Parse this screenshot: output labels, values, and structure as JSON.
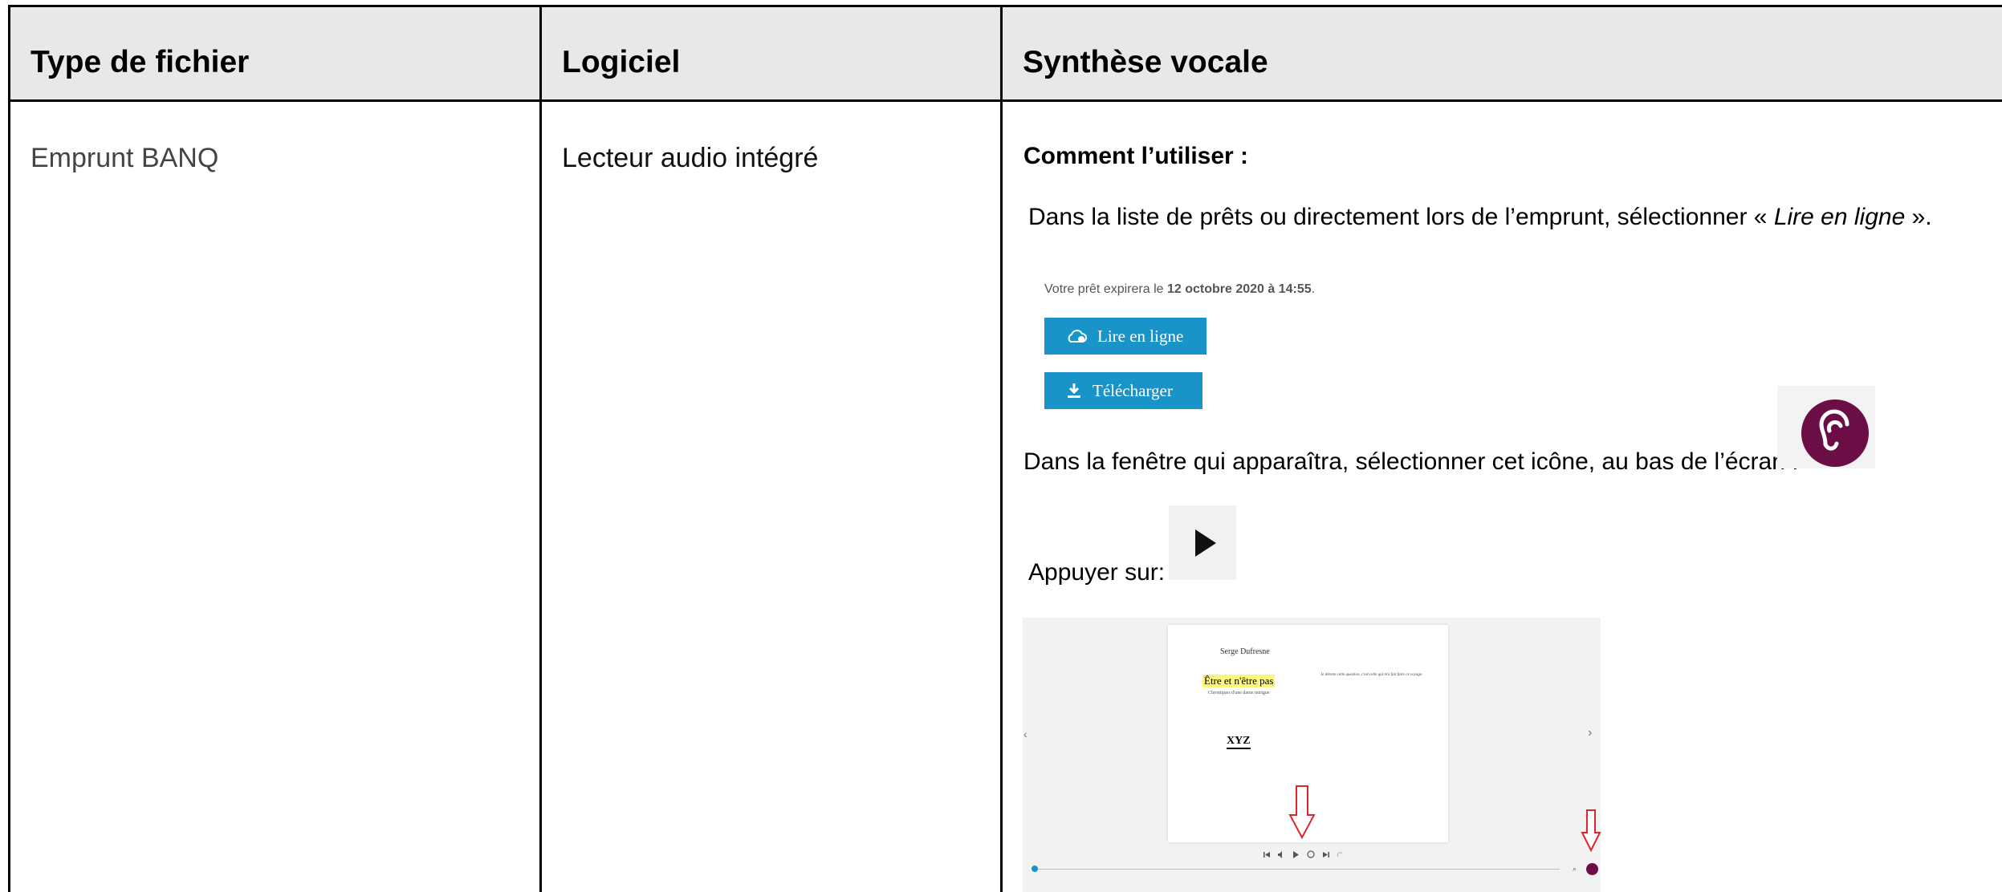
{
  "headers": [
    "Type de fichier",
    "Logiciel",
    "Synthèse vocale"
  ],
  "row": {
    "file_type": "Emprunt BANQ",
    "software": "Lecteur audio intégré",
    "howto_title": "Comment l’utiliser :",
    "step1_before": "Dans la liste de prêts ou directement lors de l’emprunt, sélectionner « ",
    "step1_em": "Lire en ligne",
    "step1_after": " ».",
    "loan_note_before": "Votre prêt expirera le ",
    "loan_note_bold": "12 octobre 2020 à 14:55",
    "loan_note_after": ".",
    "read_online_label": "Lire en ligne",
    "download_label": "Télécharger",
    "step2": "Dans la fenêtre qui apparaîtra, sélectionner cet icône, au bas de l’écran :",
    "step3": "Appuyer sur:",
    "reader": {
      "author": "Serge Dufresne",
      "book_title": "Être et n'être pas",
      "book_subtitle": "Chroniques d'une dame intrigue",
      "publisher_logo": "XYZ",
      "epigraph": "Je déteste cette question, c'est celle qui m'a fait faire ce voyage.",
      "prev_arrow": "‹",
      "next_arrow": "›"
    }
  },
  "colors": {
    "header_bg": "#e8e8e8",
    "button_blue": "#1894c8",
    "ear_purple": "#6b0e45",
    "arrow_red": "#e0262b"
  },
  "icons": [
    "cloud-read-icon",
    "download-icon",
    "ear-icon",
    "play-icon",
    "red-arrow-icon"
  ]
}
